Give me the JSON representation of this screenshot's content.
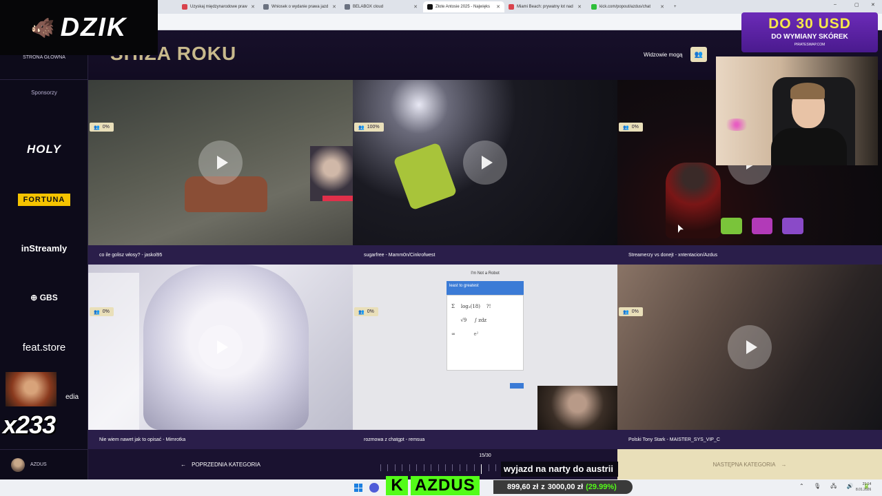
{
  "browser": {
    "tabs": [
      {
        "label": "Uzyskaj międzynarodowe praw",
        "color": "#d9434d"
      },
      {
        "label": "Wniosek o wydanie prawa jazd",
        "color": "#6b7280"
      },
      {
        "label": "BELABOX cloud",
        "color": "#6b7280"
      },
      {
        "label": "Złote Antosie 2025 - Najwięks",
        "color": "#111111"
      },
      {
        "label": "Miami Beach: prywatny lot nad",
        "color": "#d9434d"
      },
      {
        "label": "kick.com/popout/azdus/chat",
        "color": "#2fbf3a"
      }
    ],
    "new_tab": "+",
    "window_controls": [
      "–",
      "▢",
      "✕"
    ]
  },
  "sidebar": {
    "home": "STRONA GŁÓWNA",
    "sponsors_label": "Sponsorzy",
    "sponsors": [
      "HOLY",
      "FORTUNA",
      "inStreamly",
      "GBS",
      "feat.store",
      "edia"
    ],
    "user": "AZDUS"
  },
  "header": {
    "title": "SHIZA ROKU",
    "viewers_label": "Widzowie mogą"
  },
  "clips": [
    {
      "caption": "co ile golisz włosy? - jaskol95",
      "percent": "0%"
    },
    {
      "caption": "sugarfree - Mamm0n/Cinkrofwest",
      "percent": "100%"
    },
    {
      "caption": "Streamerzy vs donejt - xntentacion/Azdus",
      "percent": "0%"
    },
    {
      "caption": "Nie wiem nawet jak to opisać - Mimrotka",
      "percent": "0%"
    },
    {
      "caption": "rozmowa z chatgpt - remsua",
      "percent": "0%"
    },
    {
      "caption": "Polski Tony Stark - MAISTER_SYS_VIP_C",
      "percent": "0%"
    }
  ],
  "robot_popup": {
    "title": "I'm Not a Robot",
    "instruction": "least to greatest",
    "button": "Next"
  },
  "footer": {
    "prev": "POPRZEDNIA KATEGORIA",
    "progress": "15/30",
    "next": "NASTĘPNA KATEGORIA"
  },
  "overlay": {
    "logo": "DZIK",
    "promo_main": "DO 30 USD",
    "promo_sub": "DO WYMIANY SKÓREK",
    "promo_site": "PIRATESWAP.COM",
    "emote_count": "x233",
    "ticker": "wyjazd na narty do austrii",
    "kick_letter": "K",
    "kick_name": "AZDUS",
    "goal_current": "899,60 zł",
    "goal_of": "z",
    "goal_target": "3000,00 zł",
    "goal_percent": "(29.99%)"
  },
  "taskbar": {
    "time": "21:14",
    "date": "8.01.2026"
  }
}
